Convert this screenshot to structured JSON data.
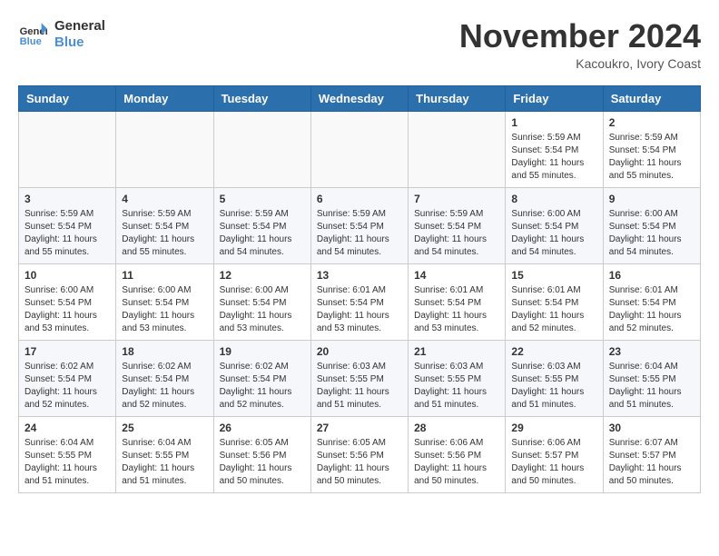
{
  "header": {
    "logo_line1": "General",
    "logo_line2": "Blue",
    "month": "November 2024",
    "location": "Kacoukro, Ivory Coast"
  },
  "weekdays": [
    "Sunday",
    "Monday",
    "Tuesday",
    "Wednesday",
    "Thursday",
    "Friday",
    "Saturday"
  ],
  "weeks": [
    [
      {
        "day": "",
        "info": ""
      },
      {
        "day": "",
        "info": ""
      },
      {
        "day": "",
        "info": ""
      },
      {
        "day": "",
        "info": ""
      },
      {
        "day": "",
        "info": ""
      },
      {
        "day": "1",
        "info": "Sunrise: 5:59 AM\nSunset: 5:54 PM\nDaylight: 11 hours\nand 55 minutes."
      },
      {
        "day": "2",
        "info": "Sunrise: 5:59 AM\nSunset: 5:54 PM\nDaylight: 11 hours\nand 55 minutes."
      }
    ],
    [
      {
        "day": "3",
        "info": "Sunrise: 5:59 AM\nSunset: 5:54 PM\nDaylight: 11 hours\nand 55 minutes."
      },
      {
        "day": "4",
        "info": "Sunrise: 5:59 AM\nSunset: 5:54 PM\nDaylight: 11 hours\nand 55 minutes."
      },
      {
        "day": "5",
        "info": "Sunrise: 5:59 AM\nSunset: 5:54 PM\nDaylight: 11 hours\nand 54 minutes."
      },
      {
        "day": "6",
        "info": "Sunrise: 5:59 AM\nSunset: 5:54 PM\nDaylight: 11 hours\nand 54 minutes."
      },
      {
        "day": "7",
        "info": "Sunrise: 5:59 AM\nSunset: 5:54 PM\nDaylight: 11 hours\nand 54 minutes."
      },
      {
        "day": "8",
        "info": "Sunrise: 6:00 AM\nSunset: 5:54 PM\nDaylight: 11 hours\nand 54 minutes."
      },
      {
        "day": "9",
        "info": "Sunrise: 6:00 AM\nSunset: 5:54 PM\nDaylight: 11 hours\nand 54 minutes."
      }
    ],
    [
      {
        "day": "10",
        "info": "Sunrise: 6:00 AM\nSunset: 5:54 PM\nDaylight: 11 hours\nand 53 minutes."
      },
      {
        "day": "11",
        "info": "Sunrise: 6:00 AM\nSunset: 5:54 PM\nDaylight: 11 hours\nand 53 minutes."
      },
      {
        "day": "12",
        "info": "Sunrise: 6:00 AM\nSunset: 5:54 PM\nDaylight: 11 hours\nand 53 minutes."
      },
      {
        "day": "13",
        "info": "Sunrise: 6:01 AM\nSunset: 5:54 PM\nDaylight: 11 hours\nand 53 minutes."
      },
      {
        "day": "14",
        "info": "Sunrise: 6:01 AM\nSunset: 5:54 PM\nDaylight: 11 hours\nand 53 minutes."
      },
      {
        "day": "15",
        "info": "Sunrise: 6:01 AM\nSunset: 5:54 PM\nDaylight: 11 hours\nand 52 minutes."
      },
      {
        "day": "16",
        "info": "Sunrise: 6:01 AM\nSunset: 5:54 PM\nDaylight: 11 hours\nand 52 minutes."
      }
    ],
    [
      {
        "day": "17",
        "info": "Sunrise: 6:02 AM\nSunset: 5:54 PM\nDaylight: 11 hours\nand 52 minutes."
      },
      {
        "day": "18",
        "info": "Sunrise: 6:02 AM\nSunset: 5:54 PM\nDaylight: 11 hours\nand 52 minutes."
      },
      {
        "day": "19",
        "info": "Sunrise: 6:02 AM\nSunset: 5:54 PM\nDaylight: 11 hours\nand 52 minutes."
      },
      {
        "day": "20",
        "info": "Sunrise: 6:03 AM\nSunset: 5:55 PM\nDaylight: 11 hours\nand 51 minutes."
      },
      {
        "day": "21",
        "info": "Sunrise: 6:03 AM\nSunset: 5:55 PM\nDaylight: 11 hours\nand 51 minutes."
      },
      {
        "day": "22",
        "info": "Sunrise: 6:03 AM\nSunset: 5:55 PM\nDaylight: 11 hours\nand 51 minutes."
      },
      {
        "day": "23",
        "info": "Sunrise: 6:04 AM\nSunset: 5:55 PM\nDaylight: 11 hours\nand 51 minutes."
      }
    ],
    [
      {
        "day": "24",
        "info": "Sunrise: 6:04 AM\nSunset: 5:55 PM\nDaylight: 11 hours\nand 51 minutes."
      },
      {
        "day": "25",
        "info": "Sunrise: 6:04 AM\nSunset: 5:55 PM\nDaylight: 11 hours\nand 51 minutes."
      },
      {
        "day": "26",
        "info": "Sunrise: 6:05 AM\nSunset: 5:56 PM\nDaylight: 11 hours\nand 50 minutes."
      },
      {
        "day": "27",
        "info": "Sunrise: 6:05 AM\nSunset: 5:56 PM\nDaylight: 11 hours\nand 50 minutes."
      },
      {
        "day": "28",
        "info": "Sunrise: 6:06 AM\nSunset: 5:56 PM\nDaylight: 11 hours\nand 50 minutes."
      },
      {
        "day": "29",
        "info": "Sunrise: 6:06 AM\nSunset: 5:57 PM\nDaylight: 11 hours\nand 50 minutes."
      },
      {
        "day": "30",
        "info": "Sunrise: 6:07 AM\nSunset: 5:57 PM\nDaylight: 11 hours\nand 50 minutes."
      }
    ]
  ]
}
